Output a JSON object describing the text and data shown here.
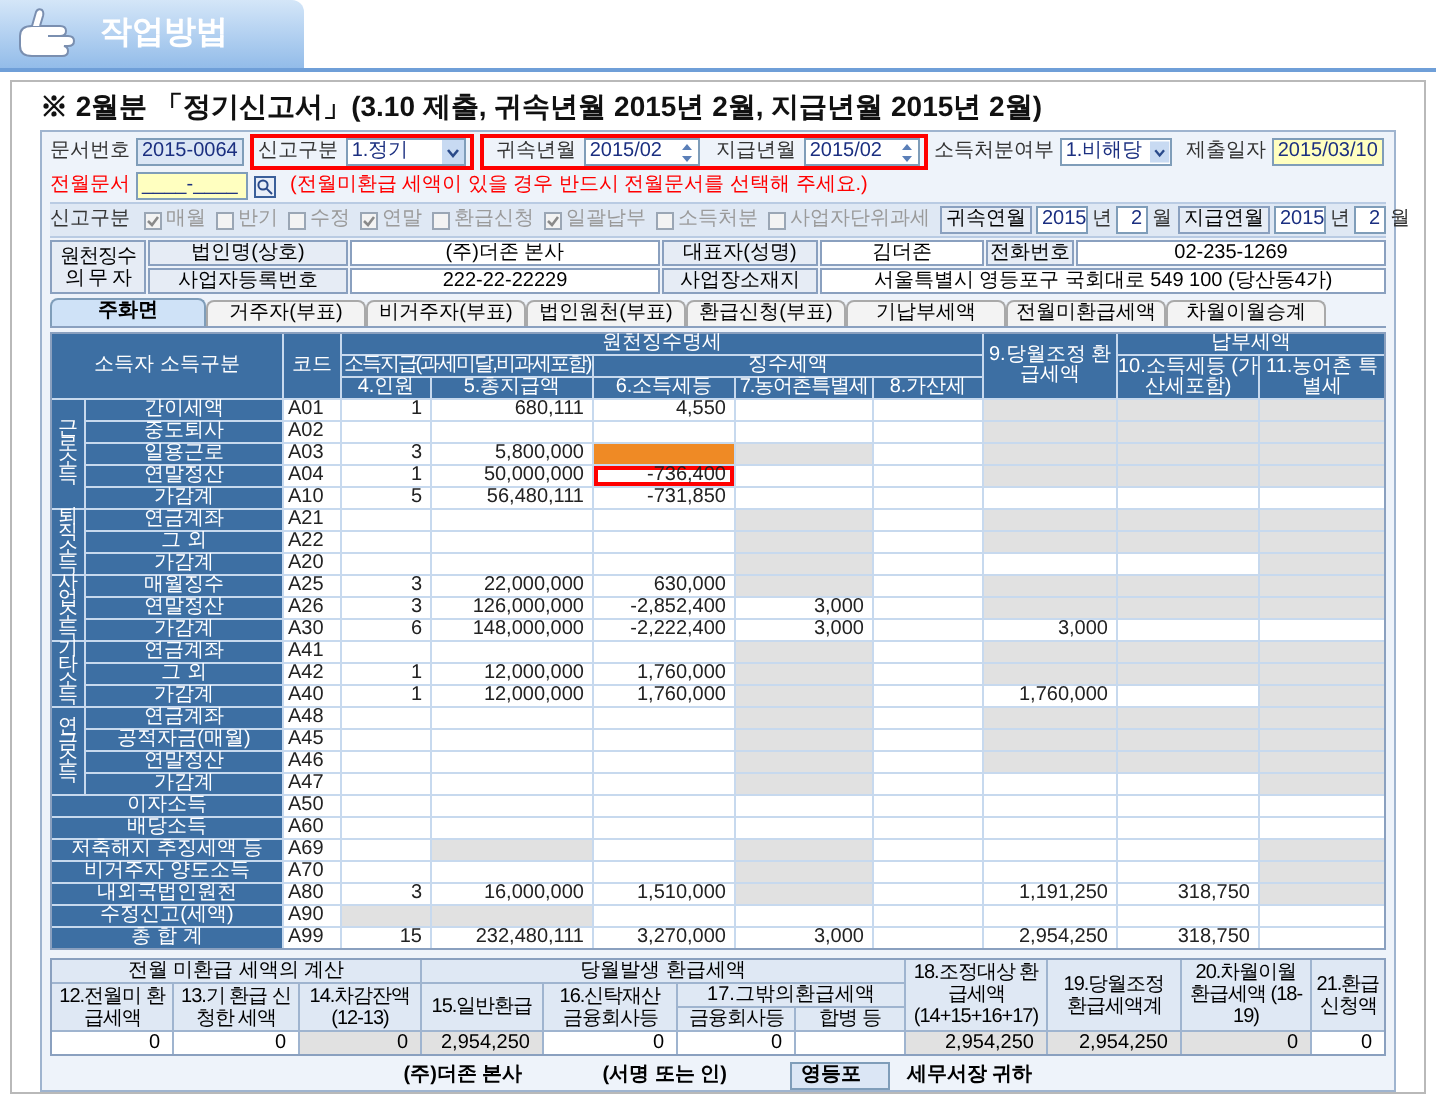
{
  "header": {
    "title": "작업방법"
  },
  "heading": "※ 2월분 「정기신고서」(3.10 제출, 귀속년월 2015년 2월, 지급년월 2015년 2월)",
  "form": {
    "doc_no": {
      "label": "문서번호",
      "value": "2015-0064"
    },
    "report_type": {
      "label": "신고구분",
      "value": "1.정기",
      "outlined": true
    },
    "period": {
      "outlined": true,
      "fields": [
        {
          "label": "귀속년월",
          "value": "2015/02"
        },
        {
          "label": "지급년월",
          "value": "2015/02"
        }
      ]
    },
    "disposition": {
      "label": "소득처분여부",
      "value": "1.비해당"
    },
    "submit_date": {
      "label": "제출일자",
      "value": "2015/03/10"
    },
    "prev_doc": {
      "label": "전월문서",
      "value": "____-____"
    },
    "notice": "(전월미환급 세액이 있을 경우 반드시 전월문서를 선택해 주세요.)",
    "flags": {
      "label": "신고구분",
      "items": [
        {
          "label": "매월",
          "checked": true
        },
        {
          "label": "반기",
          "checked": false
        },
        {
          "label": "수정",
          "checked": false
        },
        {
          "label": "연말",
          "checked": true
        },
        {
          "label": "환급신청",
          "checked": false
        },
        {
          "label": "일괄납부",
          "checked": true
        },
        {
          "label": "소득처분",
          "checked": false
        },
        {
          "label": "사업자단위과세",
          "checked": false
        }
      ]
    },
    "period_display": [
      {
        "label": "귀속연월",
        "year": "2015",
        "year_unit": "년",
        "month": "2",
        "month_unit": "월"
      },
      {
        "label": "지급연월",
        "year": "2015",
        "year_unit": "년",
        "month": "2",
        "month_unit": "월"
      }
    ]
  },
  "withholder": {
    "label": "원천징수\n의 무 자",
    "fields": [
      {
        "label": "법인명(상호)",
        "value": "(주)더존 본사"
      },
      {
        "label": "대표자(성명)",
        "value": "김더존"
      },
      {
        "label": "전화번호",
        "value": "02-235-1269"
      },
      {
        "label": "사업자등록번호",
        "value": "222-22-22229"
      },
      {
        "label": "사업장소재지",
        "value": "서울특별시 영등포구 국회대로 549 100 (당산동4가)"
      }
    ]
  },
  "tabs": [
    {
      "label": "주화면",
      "selected": true
    },
    {
      "label": "거주자(부표)",
      "selected": false
    },
    {
      "label": "비거주자(부표)",
      "selected": false
    },
    {
      "label": "법인원천(부표)",
      "selected": false
    },
    {
      "label": "환급신청(부표)",
      "selected": false
    },
    {
      "label": "기납부세액",
      "selected": false
    },
    {
      "label": "전월미환급세액",
      "selected": false
    },
    {
      "label": "차월이월승계",
      "selected": false
    }
  ],
  "table": {
    "headers": {
      "income_type": "소득자 소득구분",
      "code": "코드",
      "withholding_detail": "원천징수명세",
      "payment": "소득지급(과세미달,비과세포함)",
      "tax_collected": "징수세액",
      "count": "4.인원",
      "total_paid": "5.총지급액",
      "income_tax": "6.소득세등",
      "rural_tax": "7.농어촌특별세",
      "penalty": "8.가산세",
      "refund_adjusted": "9.당월조정 환급세액",
      "tax_due": "납부세액",
      "due_income_tax": "10.소득세등 (가산세포함)",
      "due_rural_tax": "11.농어촌 특별세"
    },
    "sections": [
      {
        "kind": "group",
        "label": "근로소득",
        "rows": [
          {
            "label": "간이세액",
            "code": "A01",
            "cells": [
              {
                "kind": "input",
                "text": "1"
              },
              {
                "kind": "input",
                "text": "680,111"
              },
              {
                "kind": "input",
                "text": "4,550"
              },
              {
                "kind": "input"
              },
              {
                "kind": "input"
              },
              {
                "kind": "shaded"
              },
              {
                "kind": "shaded"
              },
              {
                "kind": "shaded"
              }
            ]
          },
          {
            "label": "중도퇴사",
            "code": "A02",
            "cells": [
              {
                "kind": "input"
              },
              {
                "kind": "input"
              },
              {
                "kind": "input"
              },
              {
                "kind": "input"
              },
              {
                "kind": "input"
              },
              {
                "kind": "shaded"
              },
              {
                "kind": "shaded"
              },
              {
                "kind": "shaded"
              }
            ]
          },
          {
            "label": "일용근로",
            "code": "A03",
            "cells": [
              {
                "kind": "input",
                "text": "3"
              },
              {
                "kind": "input",
                "text": "5,800,000"
              },
              {
                "kind": "flagged"
              },
              {
                "kind": "shaded"
              },
              {
                "kind": "input"
              },
              {
                "kind": "shaded"
              },
              {
                "kind": "shaded"
              },
              {
                "kind": "shaded"
              }
            ]
          },
          {
            "label": "연말정산",
            "code": "A04",
            "cells": [
              {
                "kind": "input",
                "text": "1"
              },
              {
                "kind": "input",
                "text": "50,000,000"
              },
              {
                "kind": "boxed",
                "text": "-736,400"
              },
              {
                "kind": "input"
              },
              {
                "kind": "input"
              },
              {
                "kind": "shaded"
              },
              {
                "kind": "shaded"
              },
              {
                "kind": "shaded"
              }
            ]
          },
          {
            "label": "가감계",
            "code": "A10",
            "cells": [
              {
                "kind": "input",
                "text": "5"
              },
              {
                "kind": "input",
                "text": "56,480,111"
              },
              {
                "kind": "input",
                "text": "-731,850"
              },
              {
                "kind": "input"
              },
              {
                "kind": "input"
              },
              {
                "kind": "input"
              },
              {
                "kind": "input"
              },
              {
                "kind": "input"
              }
            ]
          }
        ]
      },
      {
        "kind": "group",
        "label": "퇴직소득",
        "rows": [
          {
            "label": "연금계좌",
            "code": "A21",
            "cells": [
              {
                "kind": "input"
              },
              {
                "kind": "input"
              },
              {
                "kind": "input"
              },
              {
                "kind": "shaded"
              },
              {
                "kind": "input"
              },
              {
                "kind": "shaded"
              },
              {
                "kind": "shaded"
              },
              {
                "kind": "shaded"
              }
            ]
          },
          {
            "label": "그 외",
            "code": "A22",
            "cells": [
              {
                "kind": "input"
              },
              {
                "kind": "input"
              },
              {
                "kind": "input"
              },
              {
                "kind": "shaded"
              },
              {
                "kind": "input"
              },
              {
                "kind": "shaded"
              },
              {
                "kind": "shaded"
              },
              {
                "kind": "shaded"
              }
            ]
          },
          {
            "label": "가감계",
            "code": "A20",
            "cells": [
              {
                "kind": "input"
              },
              {
                "kind": "input"
              },
              {
                "kind": "input"
              },
              {
                "kind": "shaded"
              },
              {
                "kind": "input"
              },
              {
                "kind": "input"
              },
              {
                "kind": "input"
              },
              {
                "kind": "shaded"
              }
            ]
          }
        ]
      },
      {
        "kind": "group",
        "label": "사업소득",
        "rows": [
          {
            "label": "매월징수",
            "code": "A25",
            "cells": [
              {
                "kind": "input",
                "text": "3"
              },
              {
                "kind": "input",
                "text": "22,000,000"
              },
              {
                "kind": "input",
                "text": "630,000"
              },
              {
                "kind": "shaded"
              },
              {
                "kind": "input"
              },
              {
                "kind": "shaded"
              },
              {
                "kind": "shaded"
              },
              {
                "kind": "shaded"
              }
            ]
          },
          {
            "label": "연말정산",
            "code": "A26",
            "cells": [
              {
                "kind": "input",
                "text": "3"
              },
              {
                "kind": "input",
                "text": "126,000,000"
              },
              {
                "kind": "input",
                "text": "-2,852,400"
              },
              {
                "kind": "input",
                "text": "3,000"
              },
              {
                "kind": "input"
              },
              {
                "kind": "shaded"
              },
              {
                "kind": "shaded"
              },
              {
                "kind": "shaded"
              }
            ]
          },
          {
            "label": "가감계",
            "code": "A30",
            "cells": [
              {
                "kind": "input",
                "text": "6"
              },
              {
                "kind": "input",
                "text": "148,000,000"
              },
              {
                "kind": "input",
                "text": "-2,222,400"
              },
              {
                "kind": "input",
                "text": "3,000"
              },
              {
                "kind": "input"
              },
              {
                "kind": "input",
                "text": "3,000"
              },
              {
                "kind": "input"
              },
              {
                "kind": "input"
              }
            ]
          }
        ]
      },
      {
        "kind": "group",
        "label": "기타소득",
        "rows": [
          {
            "label": "연금계좌",
            "code": "A41",
            "cells": [
              {
                "kind": "input"
              },
              {
                "kind": "input"
              },
              {
                "kind": "input"
              },
              {
                "kind": "shaded"
              },
              {
                "kind": "input"
              },
              {
                "kind": "shaded"
              },
              {
                "kind": "shaded"
              },
              {
                "kind": "shaded"
              }
            ]
          },
          {
            "label": "그 외",
            "code": "A42",
            "cells": [
              {
                "kind": "input",
                "text": "1"
              },
              {
                "kind": "input",
                "text": "12,000,000"
              },
              {
                "kind": "input",
                "text": "1,760,000"
              },
              {
                "kind": "shaded"
              },
              {
                "kind": "input"
              },
              {
                "kind": "shaded"
              },
              {
                "kind": "shaded"
              },
              {
                "kind": "shaded"
              }
            ]
          },
          {
            "label": "가감계",
            "code": "A40",
            "cells": [
              {
                "kind": "input",
                "text": "1"
              },
              {
                "kind": "input",
                "text": "12,000,000"
              },
              {
                "kind": "input",
                "text": "1,760,000"
              },
              {
                "kind": "shaded"
              },
              {
                "kind": "input"
              },
              {
                "kind": "input",
                "text": "1,760,000"
              },
              {
                "kind": "input"
              },
              {
                "kind": "shaded"
              }
            ]
          }
        ]
      },
      {
        "kind": "group",
        "label": "연금소득",
        "rows": [
          {
            "label": "연금계좌",
            "code": "A48",
            "cells": [
              {
                "kind": "input"
              },
              {
                "kind": "input"
              },
              {
                "kind": "input"
              },
              {
                "kind": "shaded"
              },
              {
                "kind": "input"
              },
              {
                "kind": "shaded"
              },
              {
                "kind": "shaded"
              },
              {
                "kind": "shaded"
              }
            ]
          },
          {
            "label": "공적자금(매월)",
            "code": "A45",
            "cells": [
              {
                "kind": "input"
              },
              {
                "kind": "input"
              },
              {
                "kind": "input"
              },
              {
                "kind": "shaded"
              },
              {
                "kind": "input"
              },
              {
                "kind": "shaded"
              },
              {
                "kind": "shaded"
              },
              {
                "kind": "shaded"
              }
            ]
          },
          {
            "label": "연말정산",
            "code": "A46",
            "cells": [
              {
                "kind": "input"
              },
              {
                "kind": "input"
              },
              {
                "kind": "input"
              },
              {
                "kind": "shaded"
              },
              {
                "kind": "input"
              },
              {
                "kind": "shaded"
              },
              {
                "kind": "shaded"
              },
              {
                "kind": "shaded"
              }
            ]
          },
          {
            "label": "가감계",
            "code": "A47",
            "cells": [
              {
                "kind": "input"
              },
              {
                "kind": "input"
              },
              {
                "kind": "input"
              },
              {
                "kind": "shaded"
              },
              {
                "kind": "input"
              },
              {
                "kind": "input"
              },
              {
                "kind": "input"
              },
              {
                "kind": "shaded"
              }
            ]
          }
        ]
      },
      {
        "kind": "row",
        "label": "이자소득",
        "code": "A50",
        "cells": [
          {
            "kind": "input"
          },
          {
            "kind": "input"
          },
          {
            "kind": "input"
          },
          {
            "kind": "input"
          },
          {
            "kind": "input"
          },
          {
            "kind": "input"
          },
          {
            "kind": "input"
          },
          {
            "kind": "input"
          }
        ]
      },
      {
        "kind": "row",
        "label": "배당소득",
        "code": "A60",
        "cells": [
          {
            "kind": "input"
          },
          {
            "kind": "input"
          },
          {
            "kind": "input"
          },
          {
            "kind": "input"
          },
          {
            "kind": "input"
          },
          {
            "kind": "input"
          },
          {
            "kind": "input"
          },
          {
            "kind": "input"
          }
        ]
      },
      {
        "kind": "row",
        "label": "저축해지 추징세액 등",
        "code": "A69",
        "cells": [
          {
            "kind": "input"
          },
          {
            "kind": "shaded"
          },
          {
            "kind": "input"
          },
          {
            "kind": "shaded"
          },
          {
            "kind": "input"
          },
          {
            "kind": "input"
          },
          {
            "kind": "input"
          },
          {
            "kind": "shaded"
          }
        ]
      },
      {
        "kind": "row",
        "label": "비거주자 양도소득",
        "code": "A70",
        "cells": [
          {
            "kind": "input"
          },
          {
            "kind": "input"
          },
          {
            "kind": "input"
          },
          {
            "kind": "shaded"
          },
          {
            "kind": "input"
          },
          {
            "kind": "input"
          },
          {
            "kind": "input"
          },
          {
            "kind": "shaded"
          }
        ]
      },
      {
        "kind": "row",
        "label": "내외국법인원천",
        "code": "A80",
        "cells": [
          {
            "kind": "input",
            "text": "3"
          },
          {
            "kind": "input",
            "text": "16,000,000"
          },
          {
            "kind": "input",
            "text": "1,510,000"
          },
          {
            "kind": "shaded"
          },
          {
            "kind": "input"
          },
          {
            "kind": "input",
            "text": "1,191,250"
          },
          {
            "kind": "input",
            "text": "318,750"
          },
          {
            "kind": "shaded"
          }
        ]
      },
      {
        "kind": "row",
        "label": "수정신고(세액)",
        "code": "A90",
        "cells": [
          {
            "kind": "shaded"
          },
          {
            "kind": "shaded"
          },
          {
            "kind": "input"
          },
          {
            "kind": "input"
          },
          {
            "kind": "input"
          },
          {
            "kind": "input"
          },
          {
            "kind": "input"
          },
          {
            "kind": "input"
          }
        ]
      },
      {
        "kind": "row",
        "label": "총 합 계",
        "code": "A99",
        "cells": [
          {
            "kind": "input",
            "text": "15"
          },
          {
            "kind": "input",
            "text": "232,480,111"
          },
          {
            "kind": "input",
            "text": "3,270,000"
          },
          {
            "kind": "input",
            "text": "3,000"
          },
          {
            "kind": "input"
          },
          {
            "kind": "input",
            "text": "2,954,250"
          },
          {
            "kind": "input",
            "text": "318,750"
          },
          {
            "kind": "input"
          }
        ]
      }
    ]
  },
  "refund": {
    "prev_title": "전월 미환급 세액의 계산",
    "current_title": "당월발생 환급세액",
    "other_title": "17.그밖의환급세액",
    "columns": [
      {
        "label": "12.전월미 환급세액",
        "value": "0",
        "kind": "input"
      },
      {
        "label": "13.기 환급 신청한 세액",
        "value": "0",
        "kind": "input"
      },
      {
        "label": "14.차감잔액 (12-13)",
        "value": "0",
        "kind": "shaded"
      },
      {
        "label": "15.일반환급",
        "value": "2,954,250",
        "kind": "shaded"
      },
      {
        "label": "16.신탁재산 금융회사등",
        "value": "0",
        "kind": "input"
      },
      {
        "label": "금융회사등",
        "value": "0",
        "kind": "input"
      },
      {
        "label": "합병 등",
        "kind": "input"
      },
      {
        "label": "18.조정대상 환급세액 (14+15+16+17)",
        "value": "2,954,250",
        "kind": "shaded"
      },
      {
        "label": "19.당월조정 환급세액계",
        "value": "2,954,250",
        "kind": "shaded"
      },
      {
        "label": "20.차월이월 환급세액 (18-19)",
        "value": "0",
        "kind": "shaded"
      },
      {
        "label": "21.환급 신청액",
        "value": "0",
        "kind": "input"
      }
    ]
  },
  "signature": {
    "company": "(주)더존 본사",
    "sign": "(서명 또는 인)",
    "office": "영등포",
    "suffix": "세무서장 귀하"
  }
}
